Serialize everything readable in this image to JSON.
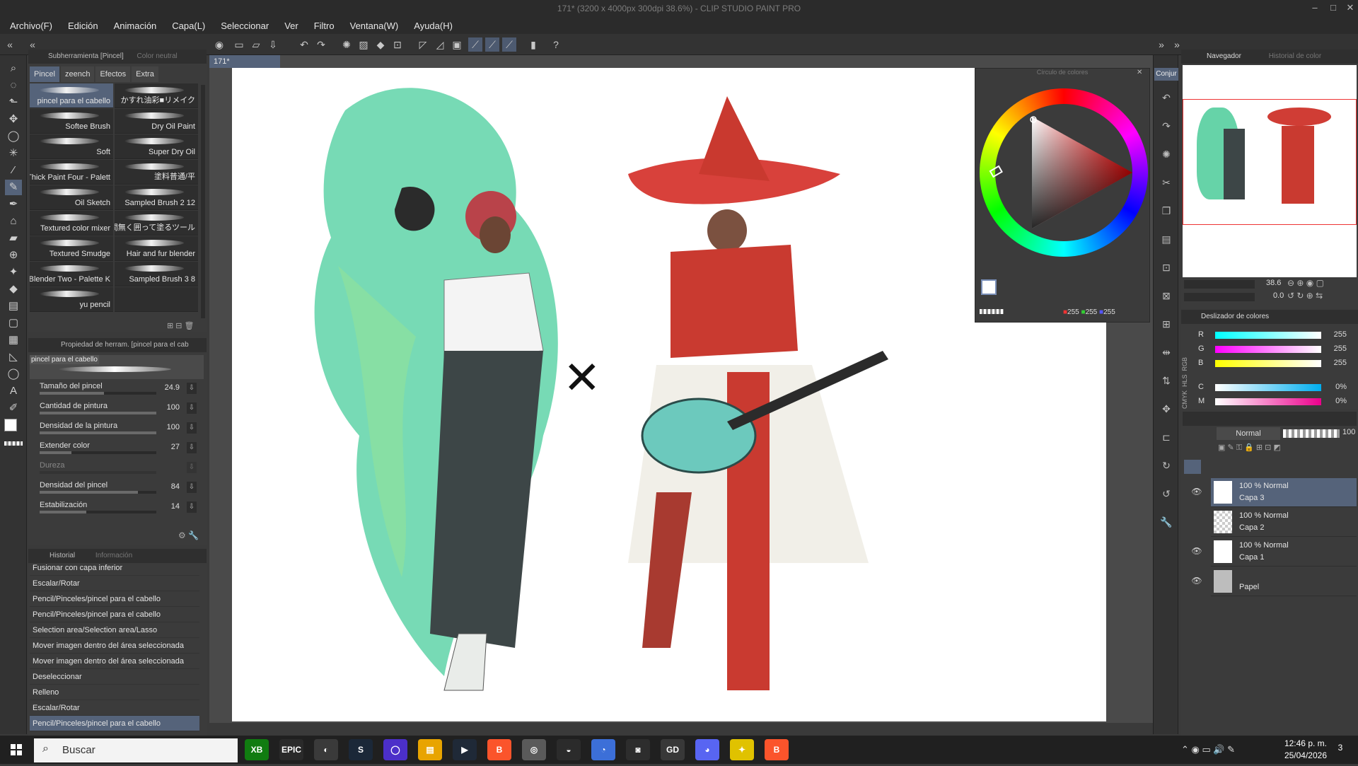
{
  "window": {
    "title": "171* (3200 x 4000px 300dpi 38.6%)  - CLIP STUDIO PAINT PRO",
    "controls": [
      "–",
      "□",
      "✕"
    ]
  },
  "menu": [
    "Archivo(F)",
    "Edición",
    "Animación",
    "Capa(L)",
    "Seleccionar",
    "Ver",
    "Filtro",
    "Ventana(W)",
    "Ayuda(H)"
  ],
  "subtool": {
    "header": "Subherramienta [Pincel]",
    "header2": "Color neutral",
    "tabs": [
      "Pincel",
      "zeench",
      "Efectos",
      "Extra"
    ],
    "brushes": [
      "pincel para el cabello",
      "かすれ油彩■リメイク",
      "Softee Brush",
      "Dry Oil Paint",
      "Soft",
      "Super Dry Oil",
      "Thick Paint Four - Palett",
      "塗料普通/平",
      "Oil Sketch",
      "Sampled Brush 2 12",
      "Textured color mixer",
      "隙間無く囲って塗るツール",
      "Textured Smudge",
      "Hair and fur blender",
      "Blender Two - Palette K",
      "Sampled Brush 3 8",
      "yu pencil",
      ""
    ]
  },
  "toolprop": {
    "header": "Propiedad de herram. [pincel para el cab",
    "brush_name": "pincel para el cabello",
    "props": [
      {
        "label": "Tamaño del pincel",
        "value": "24.9",
        "fill": 0.55
      },
      {
        "label": "Cantidad de pintura",
        "value": "100",
        "fill": 1.0
      },
      {
        "label": "Densidad de la pintura",
        "value": "100",
        "fill": 1.0
      },
      {
        "label": "Extender color",
        "value": "27",
        "fill": 0.27
      },
      {
        "label": "Dureza",
        "value": "",
        "fill": 0.0
      },
      {
        "label": "Densidad del pincel",
        "value": "84",
        "fill": 0.84
      },
      {
        "label": "Estabilización",
        "value": "14",
        "fill": 0.4
      }
    ]
  },
  "history": {
    "tabs": [
      "Historial",
      "Información"
    ],
    "items": [
      "Fusionar con capa inferior",
      "Escalar/Rotar",
      "Pencil/Pinceles/pincel para el cabello",
      "Pencil/Pinceles/pincel para el cabello",
      "Selection area/Selection area/Lasso",
      "Mover imagen dentro del área seleccionada",
      "Mover imagen dentro del área seleccionada",
      "Deseleccionar",
      "Relleno",
      "Escalar/Rotar",
      "Pencil/Pinceles/pincel para el cabello"
    ]
  },
  "canvas": {
    "tab": "171*",
    "mark": "✕"
  },
  "colorwheel": {
    "title": "Círculo de colores",
    "r": "255",
    "g": "255",
    "b": "255"
  },
  "navigator": {
    "tabs": [
      "Navegador",
      "Historial de color"
    ],
    "zoom": "38.6",
    "rotation": "0.0",
    "conj_label": "Conjur"
  },
  "colorslider": {
    "title": "Deslizador de colores",
    "rgb": [
      {
        "label": "R",
        "value": "255"
      },
      {
        "label": "G",
        "value": "255"
      },
      {
        "label": "B",
        "value": "255"
      }
    ],
    "cmyk": [
      {
        "label": "C",
        "value": "0%"
      },
      {
        "label": "M",
        "value": "0%"
      }
    ],
    "side_rgb": "RGB",
    "side_hls": "HLS",
    "side_cmyk": "CMYK"
  },
  "layers": {
    "blend_mode": "Normal",
    "opacity": "100",
    "items": [
      {
        "mode": "100 % Normal",
        "name": "Capa 3"
      },
      {
        "mode": "100 % Normal",
        "name": "Capa 2"
      },
      {
        "mode": "100 % Normal",
        "name": "Capa 1"
      },
      {
        "mode": "",
        "name": "Papel"
      }
    ]
  },
  "taskbar": {
    "search": "Buscar",
    "time": "12:46 p. m.",
    "date": "25/04/2026",
    "apps": [
      "XB",
      "EPIC",
      "◐",
      "S",
      "◯",
      "▤",
      "▶",
      "B",
      "◎",
      "◒",
      "◔",
      "◙",
      "GD",
      "◕",
      "✦",
      "B"
    ],
    "notif": "3"
  },
  "colors": {
    "accent": "#55637a",
    "panel": "#3b3b3b",
    "taskbar": "#202020"
  }
}
